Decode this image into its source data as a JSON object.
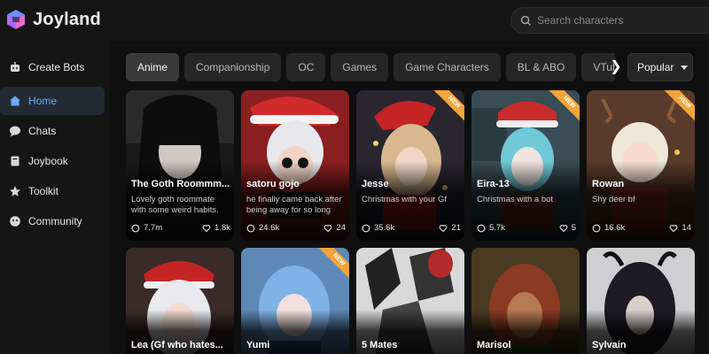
{
  "app": {
    "name": "Joyland"
  },
  "search": {
    "placeholder": "Search characters"
  },
  "sidebar": {
    "items": [
      {
        "label": "Create Bots",
        "icon": "bot-icon"
      },
      {
        "label": "Home",
        "icon": "home-icon",
        "active": true
      },
      {
        "label": "Chats",
        "icon": "chat-icon"
      },
      {
        "label": "Joybook",
        "icon": "book-icon"
      },
      {
        "label": "Toolkit",
        "icon": "toolkit-icon"
      },
      {
        "label": "Community",
        "icon": "community-icon"
      }
    ]
  },
  "tabs": [
    {
      "label": "Anime",
      "active": true
    },
    {
      "label": "Companionship"
    },
    {
      "label": "OC"
    },
    {
      "label": "Games"
    },
    {
      "label": "Game Characters"
    },
    {
      "label": "BL & ABO"
    },
    {
      "label": "VTuber"
    }
  ],
  "sort": {
    "label": "Popular"
  },
  "cards_row1": [
    {
      "name": "The Goth Roommm...",
      "desc": "Lovely goth roommate with some weird habits.",
      "chats": "7.7m",
      "likes": "1.8k",
      "badge": ""
    },
    {
      "name": "satoru gojo",
      "desc": "he finally came back after being away for so long",
      "chats": "24.6k",
      "likes": "24",
      "badge": ""
    },
    {
      "name": "Jesse",
      "desc": "Christmas with your Gf",
      "chats": "35.6k",
      "likes": "21",
      "badge": "NEW"
    },
    {
      "name": "Eira-13",
      "desc": "Christmas with a bot",
      "chats": "5.7k",
      "likes": "5",
      "badge": "NEW"
    },
    {
      "name": "Rowan",
      "desc": "Shy deer bf",
      "chats": "16.6k",
      "likes": "14",
      "badge": "NEW"
    }
  ],
  "cards_row2": [
    {
      "name": "Lea (Gf who hates...",
      "badge": ""
    },
    {
      "name": "Yumi",
      "badge": "NEW"
    },
    {
      "name": "5 Mates",
      "badge": ""
    },
    {
      "name": "Marisol",
      "badge": ""
    },
    {
      "name": "Sylvain",
      "badge": ""
    }
  ],
  "colors": {
    "accent": "#6aa9ff",
    "badge": "#f2a53a",
    "background": "#0f0f0f"
  }
}
